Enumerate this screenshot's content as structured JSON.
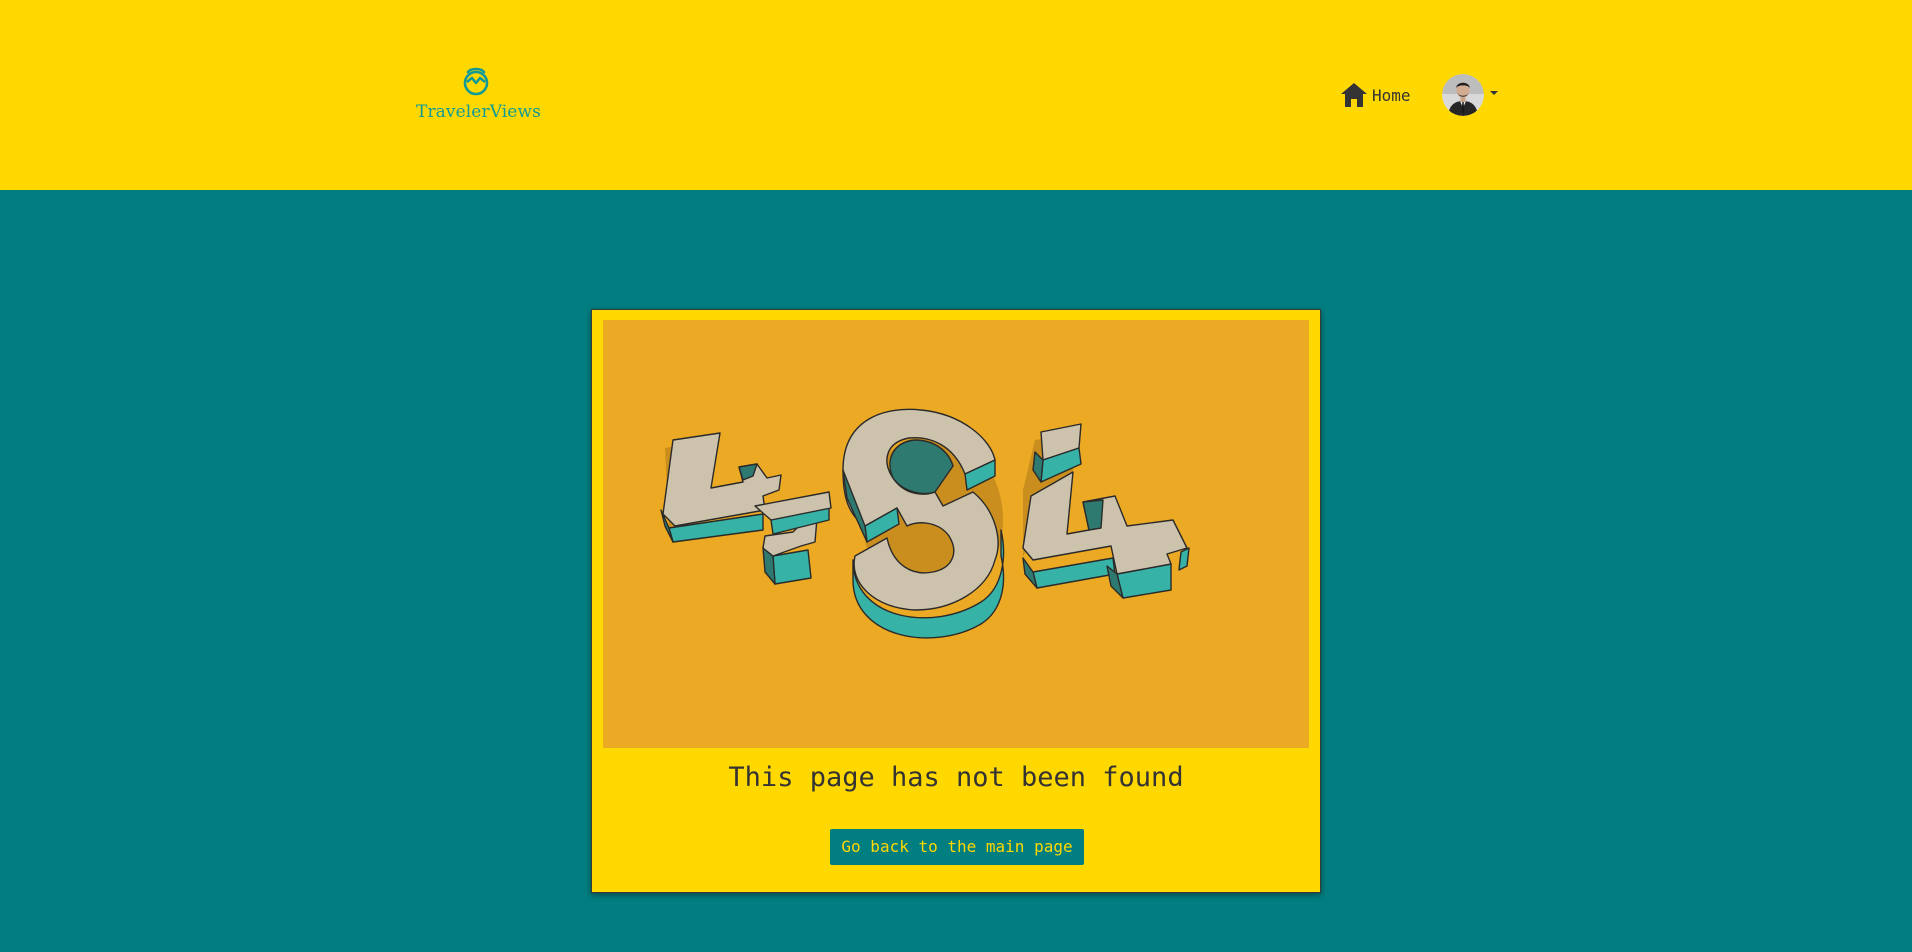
{
  "header": {
    "brand_name": "TravelerViews",
    "brand_icon": "mountain-map-pin-icon",
    "nav": {
      "home_label": "Home",
      "home_icon": "home-icon"
    },
    "user_menu": {
      "avatar": "user-avatar",
      "dropdown_icon": "caret-down-icon"
    }
  },
  "error": {
    "illustration_text": "404",
    "message": "This page has not been found",
    "back_button_label": "Go back to the main page"
  },
  "colors": {
    "header_bg": "#ffd800",
    "page_bg": "#007e80",
    "illustration_bg": "#eca924",
    "digit_face": "#cdc2ac",
    "digit_side": "#36b3a6",
    "digit_shade": "#2f7a70",
    "button_bg": "#007e80",
    "button_text": "#ffd800",
    "brand_color": "#0f9a96"
  }
}
